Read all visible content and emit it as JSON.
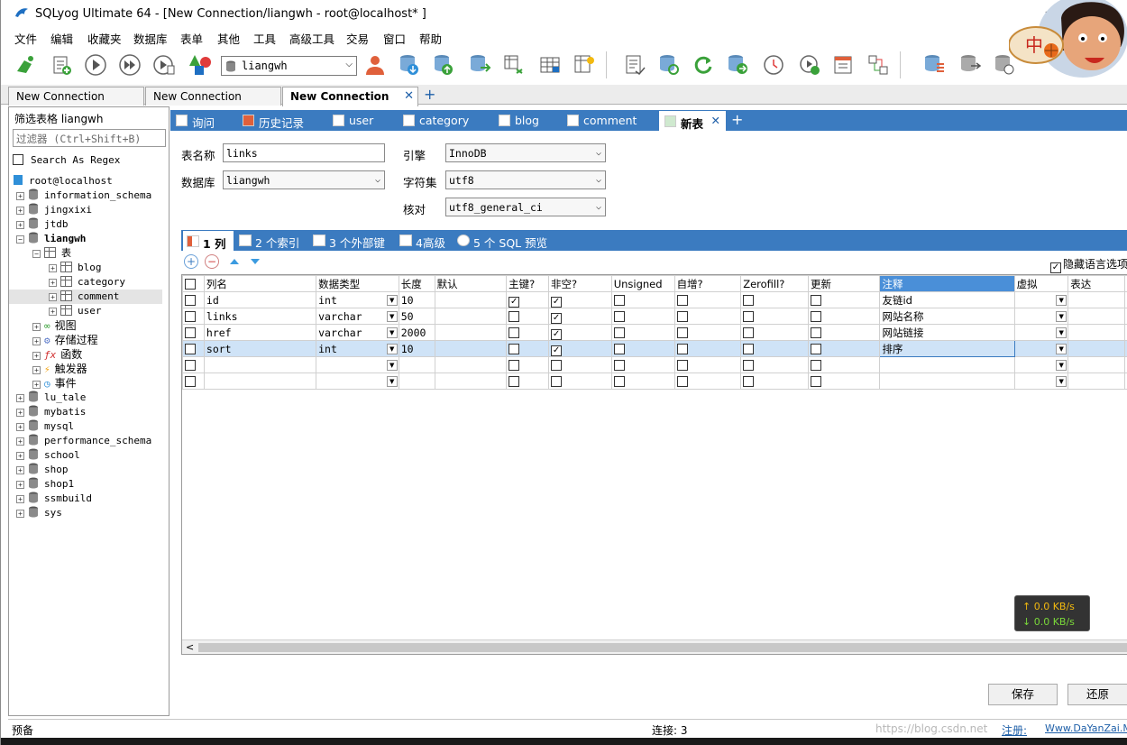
{
  "window": {
    "title": "SQLyog Ultimate 64 - [New Connection/liangwh - root@localhost* ]",
    "minimize": "—"
  },
  "menu": [
    "文件",
    "编辑",
    "收藏夹",
    "数据库",
    "表单",
    "其他",
    "工具",
    "高级工具",
    "交易",
    "窗口",
    "帮助"
  ],
  "toolbar": {
    "db_selected": "liangwh"
  },
  "avatar_text": "中",
  "conn_tabs": [
    {
      "label": "New Connection"
    },
    {
      "label": "New Connection"
    },
    {
      "label": "New Connection",
      "close": "✕"
    }
  ],
  "add_tab": "+",
  "left": {
    "header": "筛选表格 liangwh",
    "filter_placeholder": "过滤器 (Ctrl+Shift+B)",
    "regex_label": "Search As Regex",
    "root": "root@localhost",
    "databases_before": [
      "information_schema",
      "jingxixi",
      "jtdb"
    ],
    "open_db": "liangwh",
    "tables_folder": "表",
    "tables": [
      "blog",
      "category",
      "comment",
      "user"
    ],
    "folders": [
      "视图",
      "存储过程",
      "函数",
      "触发器",
      "事件"
    ],
    "databases_after": [
      "lu_tale",
      "mybatis",
      "mysql",
      "performance_schema",
      "school",
      "shop",
      "shop1",
      "ssmbuild",
      "sys"
    ]
  },
  "inner_tabs": [
    {
      "label": "询问"
    },
    {
      "label": "历史记录"
    },
    {
      "label": "user"
    },
    {
      "label": "category"
    },
    {
      "label": "blog"
    },
    {
      "label": "comment"
    },
    {
      "label": "新表",
      "close": "✕"
    }
  ],
  "form": {
    "table_name_label": "表名称",
    "table_name": "links",
    "database_label": "数据库",
    "database": "liangwh",
    "engine_label": "引擎",
    "engine": "InnoDB",
    "charset_label": "字符集",
    "charset": "utf8",
    "collation_label": "核对",
    "collation": "utf8_general_ci"
  },
  "col_tabs": [
    "1 列",
    "2 个索引",
    "3 个外部键",
    "4高级",
    "5 个 SQL 预览"
  ],
  "hide_lang": "隐藏语言选项",
  "grid": {
    "headers": [
      "列名",
      "数据类型",
      "长度",
      "默认",
      "主键?",
      "非空?",
      "Unsigned",
      "自增?",
      "Zerofill?",
      "更新",
      "注释",
      "虚拟",
      "表达"
    ],
    "rows": [
      {
        "name": "id",
        "type": "int",
        "len": "10",
        "pk": true,
        "nn": true,
        "comment": "友链id"
      },
      {
        "name": "links",
        "type": "varchar",
        "len": "50",
        "pk": false,
        "nn": true,
        "comment": "网站名称"
      },
      {
        "name": "href",
        "type": "varchar",
        "len": "2000",
        "pk": false,
        "nn": true,
        "comment": "网站链接"
      },
      {
        "name": "sort",
        "type": "int",
        "len": "10",
        "pk": false,
        "nn": true,
        "comment": "排序"
      },
      {
        "name": "",
        "type": "",
        "len": "",
        "pk": false,
        "nn": false,
        "comment": ""
      },
      {
        "name": "",
        "type": "",
        "len": "",
        "pk": false,
        "nn": false,
        "comment": ""
      }
    ]
  },
  "speed": {
    "up": "↑ 0.0 KB/s",
    "down": "↓ 0.0 KB/s"
  },
  "buttons": {
    "save": "保存",
    "revert": "还原"
  },
  "status": {
    "left": "预备",
    "conn": "连接: 3",
    "watermark": "https://blog.csdn.net",
    "reg": "注册: ",
    "site": "Www.DaYanZai.Me"
  }
}
